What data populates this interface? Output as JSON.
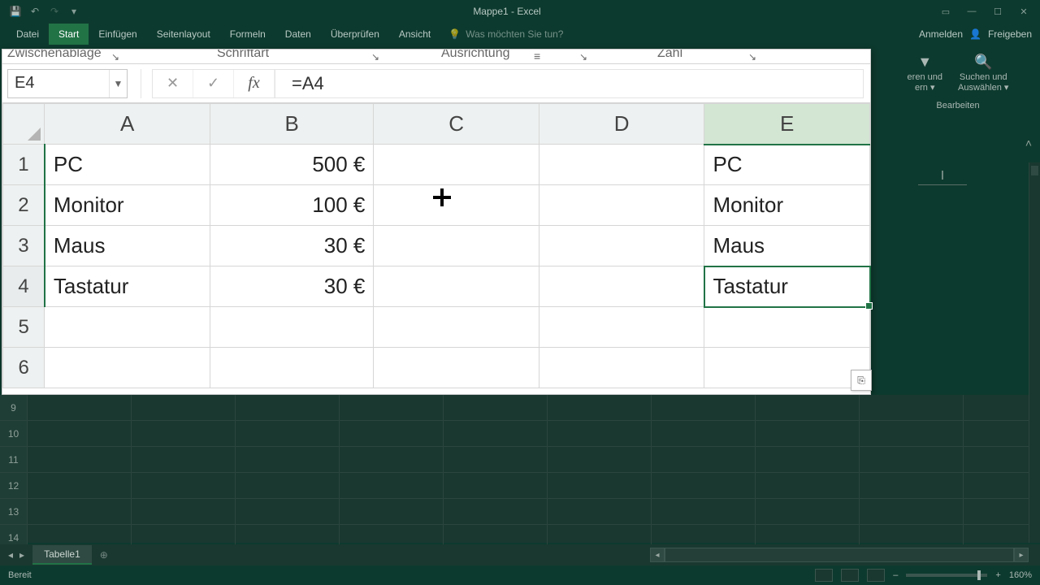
{
  "titlebar": {
    "title": "Mappe1 - Excel"
  },
  "qat": {
    "save": "💾",
    "undo": "↶",
    "redo": "↷"
  },
  "winbtns": {
    "ribbon": "▭",
    "min": "—",
    "max": "☐",
    "close": "✕"
  },
  "tabs": {
    "datei": "Datei",
    "start": "Start",
    "einfuegen": "Einfügen",
    "seitenlayout": "Seitenlayout",
    "formeln": "Formeln",
    "daten": "Daten",
    "ueberpruefen": "Überprüfen",
    "ansicht": "Ansicht",
    "tellme": "Was möchten Sie tun?",
    "anmelden": "Anmelden",
    "freigeben": "Freigeben"
  },
  "ribbon_right": {
    "sort": "eren und",
    "sort2": "ern ▾",
    "find": "Suchen und",
    "find2": "Auswählen ▾",
    "group": "Bearbeiten"
  },
  "groups": {
    "zwischen": "Zwischenablage",
    "schrift": "Schriftart",
    "ausrichtung": "Ausrichtung",
    "zahl": "Zahl"
  },
  "namebox": "E4",
  "formula": "=A4",
  "fx_label": "fx",
  "cols": {
    "A": "A",
    "B": "B",
    "C": "C",
    "D": "D",
    "E": "E"
  },
  "rows": {
    "1": {
      "hdr": "1",
      "A": "PC",
      "B": "500 €",
      "E": "PC"
    },
    "2": {
      "hdr": "2",
      "A": "Monitor",
      "B": "100 €",
      "E": "Monitor"
    },
    "3": {
      "hdr": "3",
      "A": "Maus",
      "B": "30 €",
      "E": "Maus"
    },
    "4": {
      "hdr": "4",
      "A": "Tastatur",
      "B": "30 €",
      "E": "Tastatur"
    },
    "5": {
      "hdr": "5"
    },
    "6": {
      "hdr": "6"
    }
  },
  "bg_rows": [
    "9",
    "10",
    "11",
    "12",
    "13",
    "14"
  ],
  "sheet": {
    "name": "Tabelle1",
    "add": "⊕"
  },
  "status": {
    "ready": "Bereit",
    "zoom": "160%",
    "plus": "+",
    "minus": "–"
  },
  "autofill": "⎘"
}
